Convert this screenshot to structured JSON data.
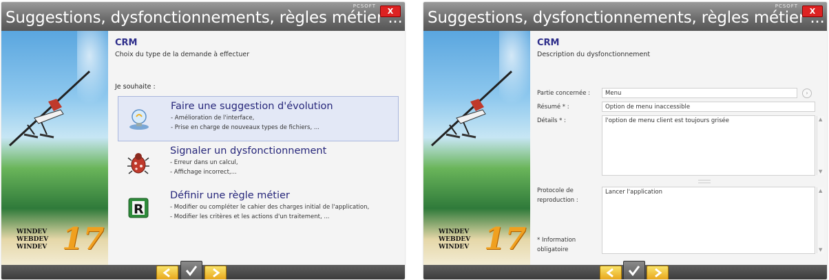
{
  "window1": {
    "title": "Suggestions, dysfonctionnements, règles métier ...",
    "brand": "PCSOFT",
    "close": "X",
    "heading": "CRM",
    "subheading": "Choix du type de la demande à effectuer",
    "prompt": "Je souhaite :",
    "options": [
      {
        "title": "Faire une suggestion d'évolution",
        "lines": [
          "- Amélioration de l'interface,",
          "- Prise en charge de nouveaux types de fichiers, ..."
        ],
        "icon": "lightbulb-icon",
        "selected": true
      },
      {
        "title": "Signaler un dysfonctionnement",
        "lines": [
          "- Erreur dans un calcul,",
          "- Affichage incorrect,..."
        ],
        "icon": "bug-icon",
        "selected": false
      },
      {
        "title": "Définir une règle métier",
        "lines": [
          "- Modifier ou compléter le cahier des charges initial de l'application,",
          "- Modifier les critères et les actions d'un traitement, ..."
        ],
        "icon": "rule-icon",
        "selected": false
      }
    ]
  },
  "window2": {
    "title": "Suggestions, dysfonctionnements, règles métier ...",
    "brand": "PCSOFT",
    "close": "X",
    "heading": "CRM",
    "subheading": "Description du dysfonctionnement",
    "fields": {
      "partie_label": "Partie concernée :",
      "partie_value": "Menu",
      "resume_label": "Résumé * :",
      "resume_value": "Option de menu inaccessible",
      "details_label": "Détails * :",
      "details_value": "l'option de menu client est toujours grisée",
      "protocole_label_1": "Protocole de",
      "protocole_label_2": "reproduction :",
      "protocole_value": "Lancer l'application",
      "mandatory_1": "* Information",
      "mandatory_2": "obligatoire"
    }
  },
  "logo": {
    "line1": "WINDEV",
    "line2": "WEBDEV",
    "line3": "WINDEV",
    "version": "17"
  },
  "colors": {
    "accent": "#26267a",
    "nav": "#e8a81d",
    "titlebar": "#6e6e6e"
  }
}
